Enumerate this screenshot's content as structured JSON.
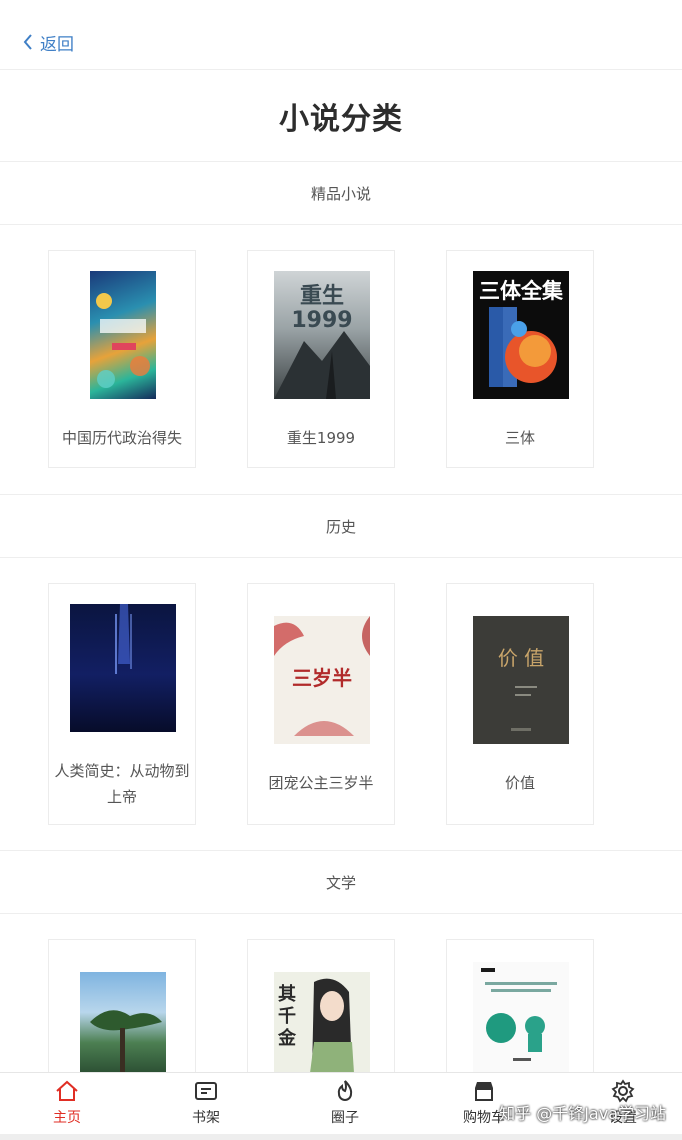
{
  "nav": {
    "back_label": "返回"
  },
  "page_title": "小说分类",
  "sections": [
    {
      "name": "精品小说",
      "books": [
        {
          "title": "中国历代政治得失",
          "cover_text": ""
        },
        {
          "title": "重生1999",
          "cover_text": "重生1999"
        },
        {
          "title": "三体",
          "cover_text": "三体全集"
        }
      ]
    },
    {
      "name": "历史",
      "books": [
        {
          "title": "人类简史：从动物到上帝",
          "cover_text": ""
        },
        {
          "title": "团宠公主三岁半",
          "cover_text": "三岁半"
        },
        {
          "title": "价值",
          "cover_text": "价 值"
        }
      ]
    },
    {
      "name": "文学",
      "books": [
        {
          "title": "",
          "cover_text": ""
        },
        {
          "title": "",
          "cover_text": "其千金"
        },
        {
          "title": "",
          "cover_text": ""
        }
      ]
    }
  ],
  "tabbar": [
    {
      "label": "主页",
      "icon": "home-icon",
      "active": true
    },
    {
      "label": "书架",
      "icon": "bookshelf-icon",
      "active": false
    },
    {
      "label": "圈子",
      "icon": "fire-icon",
      "active": false
    },
    {
      "label": "购物车",
      "icon": "store-icon",
      "active": false
    },
    {
      "label": "设置",
      "icon": "gear-icon",
      "active": false
    }
  ],
  "watermark": "知乎 @千锋Java学习站",
  "colors": {
    "accent": "#e02e24",
    "link": "#3f7fc6"
  }
}
